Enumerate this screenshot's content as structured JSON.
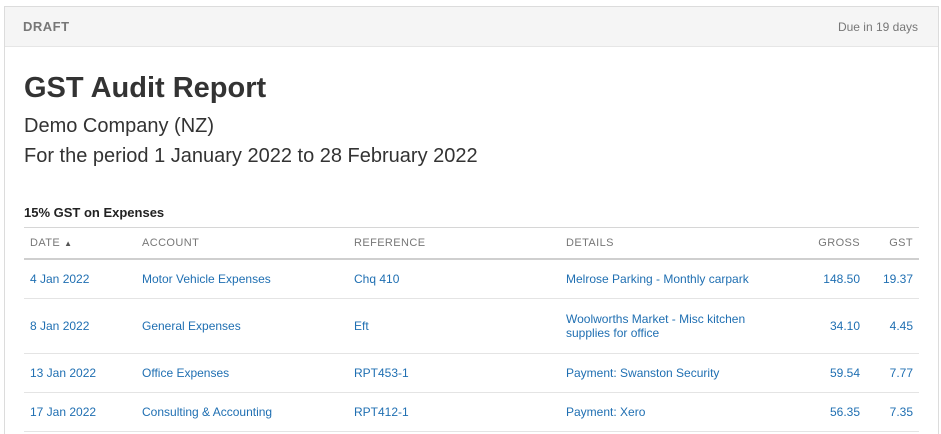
{
  "header": {
    "status": "DRAFT",
    "due": "Due in 19 days"
  },
  "report": {
    "title": "GST Audit Report",
    "company": "Demo Company (NZ)",
    "period": "For the period 1 January 2022 to 28 February 2022"
  },
  "section": {
    "title": "15% GST on Expenses"
  },
  "table": {
    "columns": {
      "date": "DATE",
      "account": "ACCOUNT",
      "reference": "REFERENCE",
      "details": "DETAILS",
      "gross": "GROSS",
      "gst": "GST"
    },
    "rows": [
      {
        "date": "4 Jan 2022",
        "account": "Motor Vehicle Expenses",
        "reference": "Chq 410",
        "details": "Melrose Parking - Monthly carpark",
        "gross": "148.50",
        "gst": "19.37"
      },
      {
        "date": "8 Jan 2022",
        "account": "General Expenses",
        "reference": "Eft",
        "details": "Woolworths Market - Misc kitchen supplies for office",
        "gross": "34.10",
        "gst": "4.45"
      },
      {
        "date": "13 Jan 2022",
        "account": "Office Expenses",
        "reference": "RPT453-1",
        "details": "Payment: Swanston Security",
        "gross": "59.54",
        "gst": "7.77"
      },
      {
        "date": "17 Jan 2022",
        "account": "Consulting & Accounting",
        "reference": "RPT412-1",
        "details": "Payment: Xero",
        "gross": "56.35",
        "gst": "7.35"
      }
    ]
  },
  "icons": {
    "sort": "sort-ascending-icon"
  },
  "colors": {
    "link": "#1f6fb2",
    "header_bg": "#f5f5f5"
  }
}
